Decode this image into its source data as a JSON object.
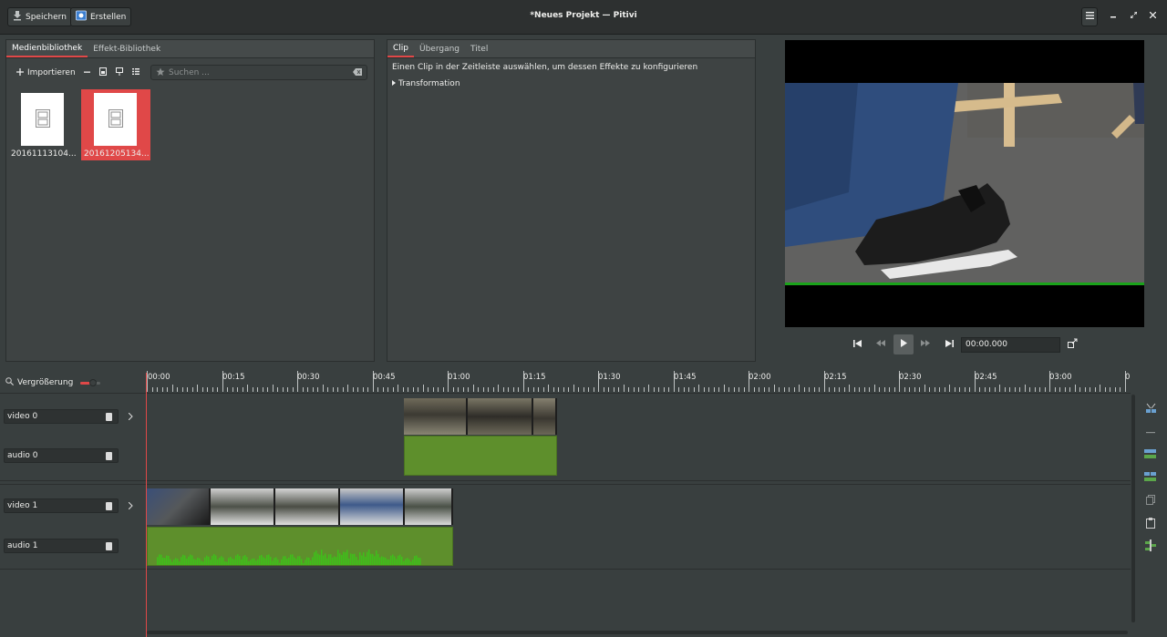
{
  "window": {
    "title": "*Neues Projekt — Pitivi",
    "save_label": "Speichern",
    "render_label": "Erstellen"
  },
  "media_library": {
    "tabs": [
      {
        "label": "Medienbibliothek",
        "active": true
      },
      {
        "label": "Effekt-Bibliothek",
        "active": false
      }
    ],
    "import_label": "Importieren",
    "search_placeholder": "Suchen ...",
    "items": [
      {
        "label": "20161113104...",
        "selected": false
      },
      {
        "label": "20161205134...",
        "selected": true
      }
    ]
  },
  "clip_panel": {
    "tabs": [
      {
        "label": "Clip",
        "active": true
      },
      {
        "label": "Übergang",
        "active": false
      },
      {
        "label": "Titel",
        "active": false
      }
    ],
    "hint": "Einen Clip in der Zeitleiste auswählen, um dessen Effekte zu konfigurieren",
    "expander": "Transformation"
  },
  "viewer": {
    "timecode": "00:00.000"
  },
  "timeline": {
    "zoom_label": "Vergrößerung",
    "ruler_labels": [
      "00:00",
      "00:15",
      "00:30",
      "00:45",
      "01:00",
      "01:15",
      "01:30",
      "01:45",
      "02:00",
      "02:15",
      "02:30",
      "02:45",
      "03:00",
      "0"
    ],
    "tracks": [
      {
        "label": "video 0"
      },
      {
        "label": "audio 0"
      },
      {
        "label": "video 1"
      },
      {
        "label": "audio 1"
      }
    ]
  },
  "colors": {
    "accent": "#e04848",
    "clip_audio": "#5e8f2c",
    "waveform": "#3fbf1a"
  }
}
